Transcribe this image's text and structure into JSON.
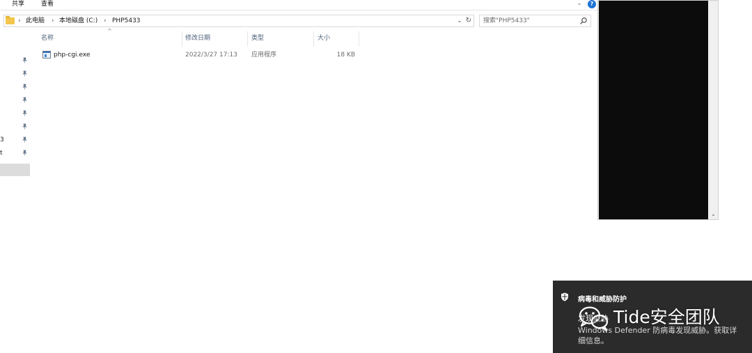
{
  "ribbon": {
    "tabs": [
      "共享",
      "查看"
    ]
  },
  "address": {
    "crumbs": [
      "此电脑",
      "本地磁盘 (C:)",
      "PHP5433"
    ]
  },
  "search": {
    "placeholder": "搜索\"PHP5433\""
  },
  "nav": {
    "cut_labels": [
      "3",
      "t"
    ]
  },
  "columns": {
    "name": "名称",
    "modified": "修改日期",
    "type": "类型",
    "size": "大小"
  },
  "files": [
    {
      "name": "php-cgi.exe",
      "modified": "2022/3/27 17:13",
      "type": "应用程序",
      "size": "18 KB"
    }
  ],
  "toast": {
    "title": "病毒和威胁防护",
    "heading": "发现威胁",
    "body": "Windows Defender 防病毒发现威胁。获取详细信息。"
  },
  "watermark": {
    "text": "Tide安全团队"
  },
  "colors": {
    "console_bg": "#0c0c0c",
    "toast_bg": "#2b2b2b",
    "folder": "#f3c74d",
    "help": "#1e74d6"
  }
}
